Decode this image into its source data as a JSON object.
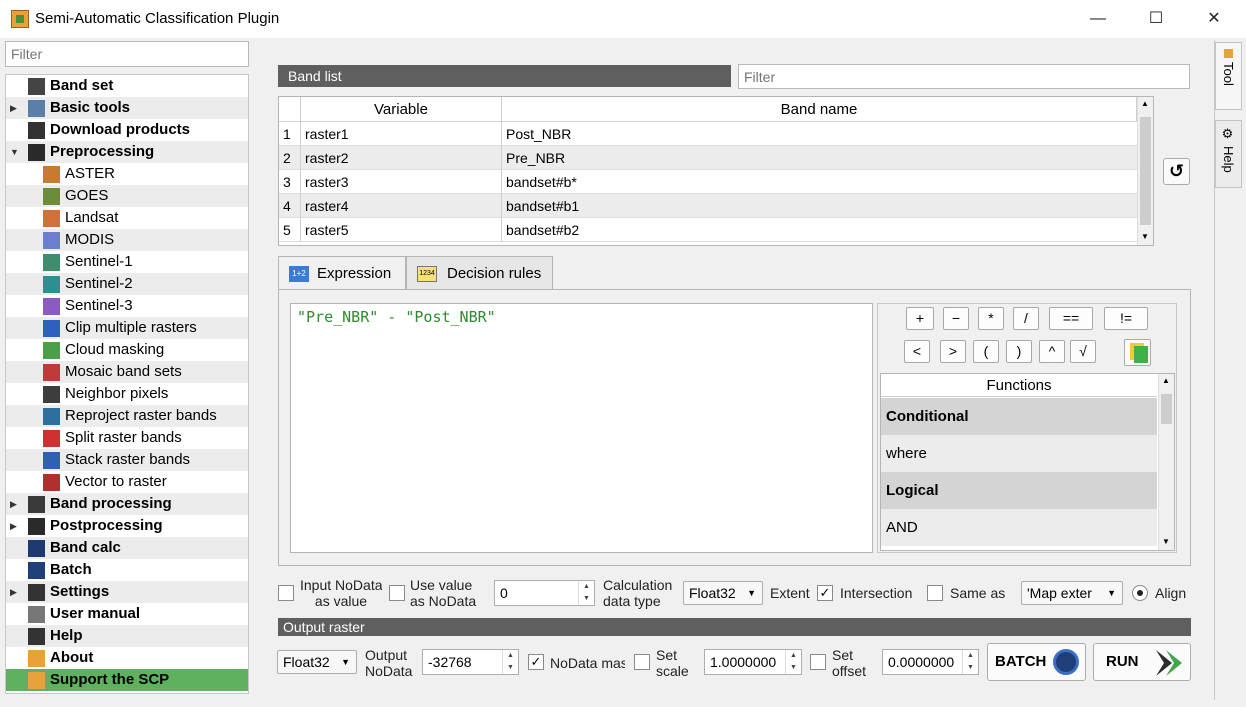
{
  "window": {
    "title": "Semi-Automatic Classification Plugin",
    "minimize": "—",
    "maximize": "☐",
    "close": "✕"
  },
  "sidebar": {
    "filter_placeholder": "Filter",
    "items": [
      {
        "label": "Band set",
        "level": 0,
        "icon": "band-set-icon"
      },
      {
        "label": "Basic tools",
        "level": 0,
        "icon": "basic-tools-icon"
      },
      {
        "label": "Download products",
        "level": 0,
        "icon": "download-icon"
      },
      {
        "label": "Preprocessing",
        "level": 0,
        "icon": "preprocessing-icon"
      },
      {
        "label": "ASTER",
        "level": 1,
        "icon": "aster-icon"
      },
      {
        "label": "GOES",
        "level": 1,
        "icon": "goes-icon"
      },
      {
        "label": "Landsat",
        "level": 1,
        "icon": "landsat-icon"
      },
      {
        "label": "MODIS",
        "level": 1,
        "icon": "modis-icon"
      },
      {
        "label": "Sentinel-1",
        "level": 1,
        "icon": "sentinel1-icon"
      },
      {
        "label": "Sentinel-2",
        "level": 1,
        "icon": "sentinel2-icon"
      },
      {
        "label": "Sentinel-3",
        "level": 1,
        "icon": "sentinel3-icon"
      },
      {
        "label": "Clip multiple rasters",
        "level": 1,
        "icon": "clip-icon"
      },
      {
        "label": "Cloud masking",
        "level": 1,
        "icon": "cloud-mask-icon"
      },
      {
        "label": "Mosaic band sets",
        "level": 1,
        "icon": "mosaic-icon"
      },
      {
        "label": "Neighbor pixels",
        "level": 1,
        "icon": "neighbor-icon"
      },
      {
        "label": "Reproject raster bands",
        "level": 1,
        "icon": "reproject-icon"
      },
      {
        "label": "Split raster bands",
        "level": 1,
        "icon": "split-icon"
      },
      {
        "label": "Stack raster bands",
        "level": 1,
        "icon": "stack-icon"
      },
      {
        "label": "Vector to raster",
        "level": 1,
        "icon": "vector-raster-icon"
      },
      {
        "label": "Band processing",
        "level": 0,
        "icon": "band-processing-icon"
      },
      {
        "label": "Postprocessing",
        "level": 0,
        "icon": "postprocessing-icon"
      },
      {
        "label": "Band calc",
        "level": 0,
        "icon": "band-calc-icon"
      },
      {
        "label": "Batch",
        "level": 0,
        "icon": "batch-icon"
      },
      {
        "label": "Settings",
        "level": 0,
        "icon": "settings-icon"
      },
      {
        "label": "User manual",
        "level": 0,
        "icon": "manual-icon"
      },
      {
        "label": "Help",
        "level": 0,
        "icon": "help-icon"
      },
      {
        "label": "About",
        "level": 0,
        "icon": "about-icon"
      },
      {
        "label": "Support the SCP",
        "level": 0,
        "icon": "support-icon"
      }
    ]
  },
  "band_list": {
    "header": "Band list",
    "filter_placeholder": "Filter",
    "columns": [
      "Variable",
      "Band name"
    ],
    "rows": [
      {
        "n": "1",
        "variable": "raster1",
        "band": "Post_NBR"
      },
      {
        "n": "2",
        "variable": "raster2",
        "band": "Pre_NBR"
      },
      {
        "n": "3",
        "variable": "raster3",
        "band": "bandset#b*"
      },
      {
        "n": "4",
        "variable": "raster4",
        "band": "bandset#b1"
      },
      {
        "n": "5",
        "variable": "raster5",
        "band": "bandset#b2"
      }
    ]
  },
  "tabs": {
    "expression": "Expression",
    "decision_rules": "Decision rules"
  },
  "expression": {
    "text": "\"Pre_NBR\" - \"Post_NBR\""
  },
  "operators": {
    "row1": [
      "+",
      "−",
      "*",
      "/",
      "==",
      "!="
    ],
    "row2": [
      "<",
      ">",
      "(",
      ")",
      "^",
      "√"
    ]
  },
  "functions": {
    "header": "Functions",
    "items": [
      {
        "label": "Conditional",
        "bold": true
      },
      {
        "label": "where",
        "bold": false
      },
      {
        "label": "Logical",
        "bold": true
      },
      {
        "label": "AND",
        "bold": false
      }
    ]
  },
  "options": {
    "input_nodata_line1": "Input NoData",
    "input_nodata_line2": "as value",
    "use_value_line1": "Use value",
    "use_value_line2": "as NoData",
    "nodata_value": "0",
    "calc_type_line1": "Calculation",
    "calc_type_line2": "data type",
    "calc_type_value": "Float32",
    "extent_label": "Extent",
    "intersection_label": "Intersection",
    "same_as_label": "Same as",
    "map_extent_value": "'Map exter",
    "align_label": "Align"
  },
  "output": {
    "header": "Output raster",
    "type_value": "Float32",
    "output_nodata_line1": "Output",
    "output_nodata_line2": "NoData",
    "nodata_value": "-32768",
    "nodata_mask_label": "NoData mas",
    "set_scale_line1": "Set",
    "set_scale_line2": "scale",
    "scale_value": "1.0000000",
    "set_offset_line1": "Set",
    "set_offset_line2": "offset",
    "offset_value": "0.0000000",
    "batch_label": "BATCH",
    "run_label": "RUN"
  },
  "side_tabs": {
    "tool": "Tool",
    "help": "Help"
  },
  "colors": {
    "accent_green": "#5fb05f",
    "header_gray": "#5f5f5f",
    "expression_green": "#2e8b2e"
  }
}
